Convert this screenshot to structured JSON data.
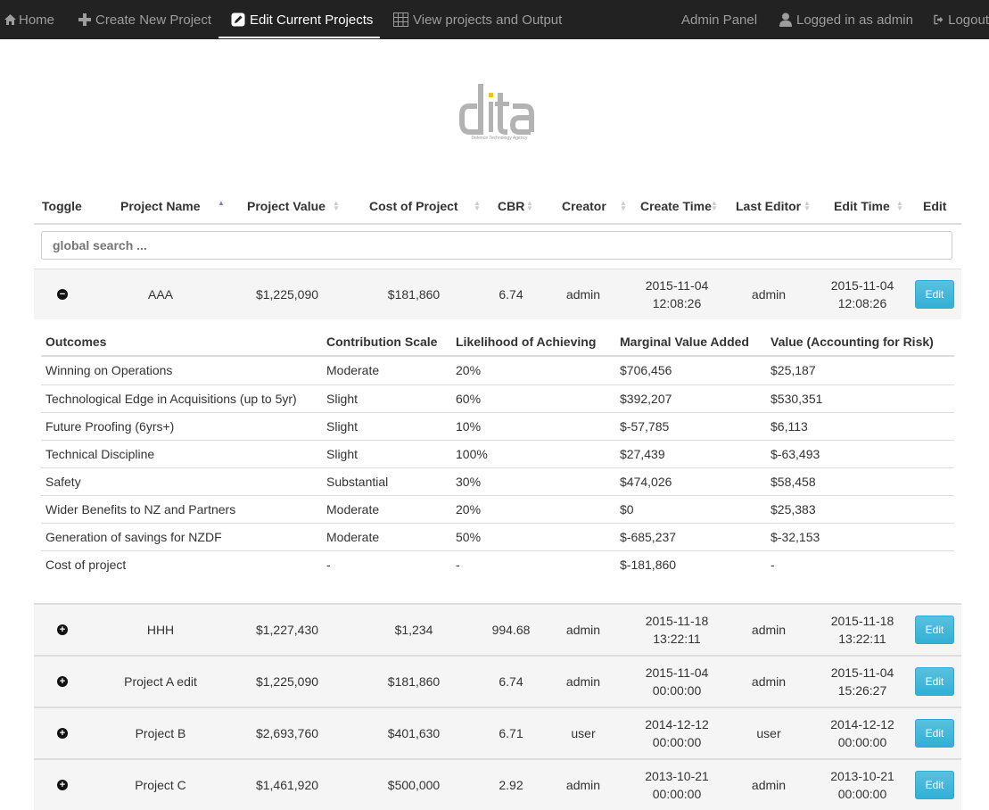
{
  "navbar": {
    "home": "Home",
    "create": "Create New Project",
    "edit_current": "Edit Current Projects",
    "view": "View projects and Output",
    "admin_panel": "Admin Panel",
    "logged_in": "Logged in as admin",
    "logout": "Logout"
  },
  "logo": {
    "text": "dta",
    "subtitle": "Defence Technology Agency"
  },
  "table": {
    "headers": {
      "toggle": "Toggle",
      "project_name": "Project Name",
      "project_value": "Project Value",
      "cost": "Cost of Project",
      "cbr": "CBR",
      "creator": "Creator",
      "create_time": "Create Time",
      "last_editor": "Last Editor",
      "edit_time": "Edit Time",
      "edit": "Edit"
    },
    "search_placeholder": "global search ...",
    "edit_label": "Edit",
    "rows": [
      {
        "name": "AAA",
        "value": "$1,225,090",
        "cost": "$181,860",
        "cbr": "6.74",
        "creator": "admin",
        "create_date": "2015-11-04",
        "create_time": "12:08:26",
        "editor": "admin",
        "edit_date": "2015-11-04",
        "edit_time": "12:08:26",
        "expanded": true
      },
      {
        "name": "HHH",
        "value": "$1,227,430",
        "cost": "$1,234",
        "cbr": "994.68",
        "creator": "admin",
        "create_date": "2015-11-18",
        "create_time": "13:22:11",
        "editor": "admin",
        "edit_date": "2015-11-18",
        "edit_time": "13:22:11",
        "expanded": false
      },
      {
        "name": "Project A edit",
        "value": "$1,225,090",
        "cost": "$181,860",
        "cbr": "6.74",
        "creator": "admin",
        "create_date": "2015-11-04",
        "create_time": "00:00:00",
        "editor": "admin",
        "edit_date": "2015-11-04",
        "edit_time": "15:26:27",
        "expanded": false
      },
      {
        "name": "Project B",
        "value": "$2,693,760",
        "cost": "$401,630",
        "cbr": "6.71",
        "creator": "user",
        "create_date": "2014-12-12",
        "create_time": "00:00:00",
        "editor": "user",
        "edit_date": "2014-12-12",
        "edit_time": "00:00:00",
        "expanded": false
      },
      {
        "name": "Project C",
        "value": "$1,461,920",
        "cost": "$500,000",
        "cbr": "2.92",
        "creator": "admin",
        "create_date": "2013-10-21",
        "create_time": "00:00:00",
        "editor": "admin",
        "edit_date": "2013-10-21",
        "edit_time": "00:00:00",
        "expanded": false
      }
    ]
  },
  "detail": {
    "headers": {
      "outcomes": "Outcomes",
      "contribution": "Contribution Scale",
      "likelihood": "Likelihood of Achieving",
      "marginal": "Marginal Value Added",
      "value_risk": "Value (Accounting for Risk)"
    },
    "rows": [
      {
        "outcome": "Winning on Operations",
        "scale": "Moderate",
        "likelihood": "20%",
        "marginal": "$706,456",
        "risk": "$25,187"
      },
      {
        "outcome": "Technological Edge in Acquisitions (up to 5yr)",
        "scale": "Slight",
        "likelihood": "60%",
        "marginal": "$392,207",
        "risk": "$530,351"
      },
      {
        "outcome": "Future Proofing (6yrs+)",
        "scale": "Slight",
        "likelihood": "10%",
        "marginal": "$-57,785",
        "risk": "$6,113"
      },
      {
        "outcome": "Technical Discipline",
        "scale": "Slight",
        "likelihood": "100%",
        "marginal": "$27,439",
        "risk": "$-63,493"
      },
      {
        "outcome": "Safety",
        "scale": "Substantial",
        "likelihood": "30%",
        "marginal": "$474,026",
        "risk": "$58,458"
      },
      {
        "outcome": "Wider Benefits to NZ and Partners",
        "scale": "Moderate",
        "likelihood": "20%",
        "marginal": "$0",
        "risk": "$25,383"
      },
      {
        "outcome": "Generation of savings for NZDF",
        "scale": "Moderate",
        "likelihood": "50%",
        "marginal": "$-685,237",
        "risk": "$-32,153"
      },
      {
        "outcome": "Cost of project",
        "scale": "-",
        "likelihood": "-",
        "marginal": "$-181,860",
        "risk": "-"
      }
    ]
  },
  "icons": {
    "toggle_expanded": "minus-circle-icon",
    "toggle_collapsed": "plus-circle-icon"
  },
  "colors": {
    "navbar_bg": "#222222",
    "edit_button": "#31b0d5",
    "row_bg": "#f5f5f5"
  }
}
